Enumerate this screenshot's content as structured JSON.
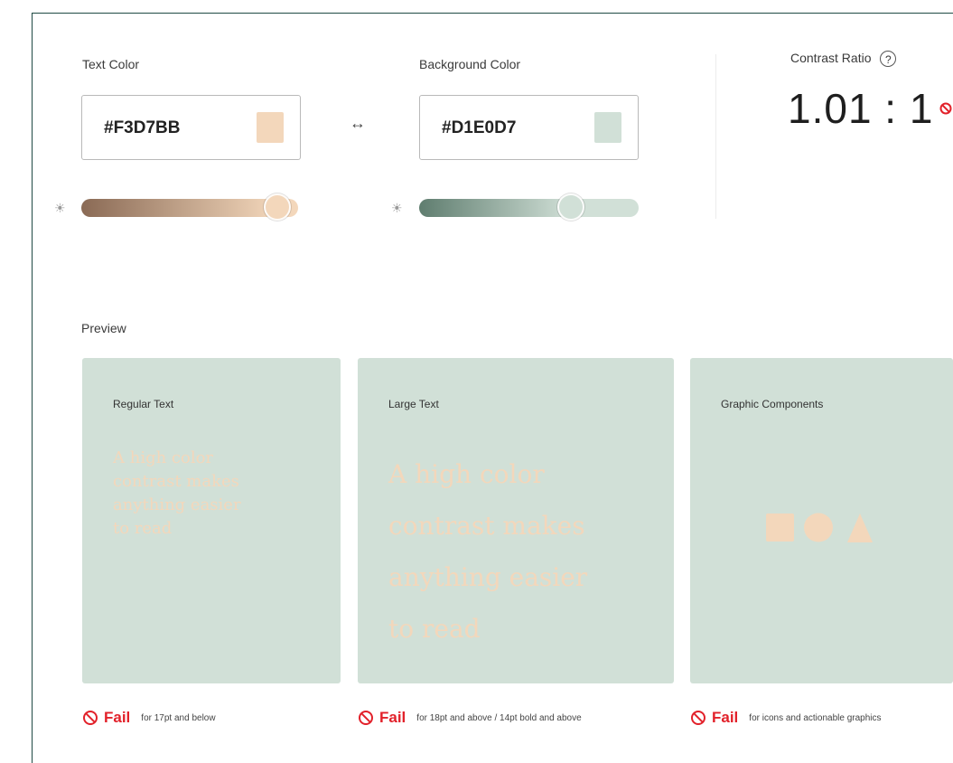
{
  "text_color": {
    "label": "Text Color",
    "value": "#F3D7BB",
    "swatch": "#F3D7BB",
    "slider_gradient": [
      "#8a6a55",
      "#f3d7bb"
    ],
    "slider_level": 0.96
  },
  "background_color": {
    "label": "Background Color",
    "value": "#D1E0D7",
    "swatch": "#D1E0D7",
    "slider_gradient": [
      "#5f7d6f",
      "#d1e0d7"
    ],
    "slider_level": 0.72
  },
  "swap_icon": "↔",
  "contrast": {
    "title": "Contrast Ratio",
    "help_icon": "?",
    "value": "1.01 : 1",
    "status_color": "#e2212a"
  },
  "preview": {
    "title": "Preview",
    "cards": [
      {
        "title": "Regular Text",
        "lines": [
          "A high color",
          "contrast makes",
          "anything easier",
          "to read"
        ]
      },
      {
        "title": "Large Text",
        "lines": [
          "A high color",
          "contrast makes",
          "anything easier",
          "to read"
        ]
      },
      {
        "title": "Graphic Components"
      }
    ]
  },
  "results": [
    {
      "label": "Fail",
      "note": "for 17pt and below"
    },
    {
      "label": "Fail",
      "note": "for 18pt and above / 14pt bold and above"
    },
    {
      "label": "Fail",
      "note": "for icons and actionable graphics"
    }
  ]
}
